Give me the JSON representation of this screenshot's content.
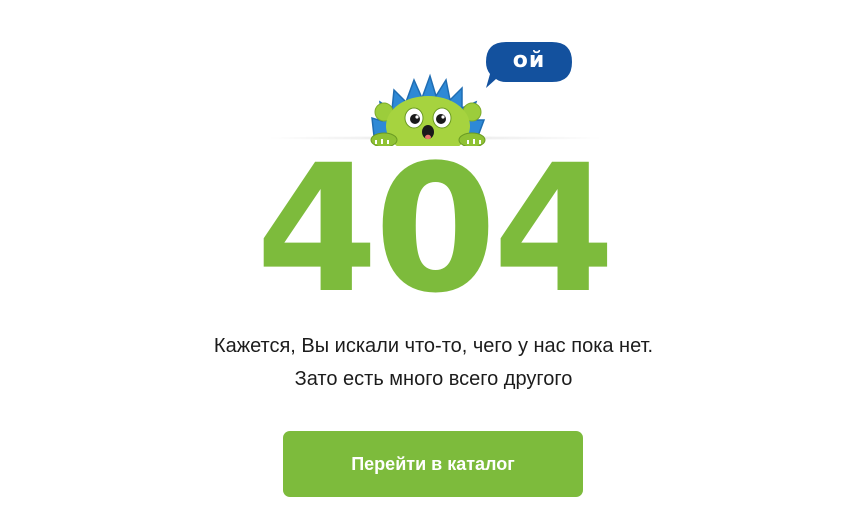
{
  "speech_bubble": {
    "text": "ой"
  },
  "error": {
    "code": "404"
  },
  "message": {
    "line1": "Кажется, Вы искали что-то, чего у нас пока нет.",
    "line2": "Зато есть много всего другого"
  },
  "button": {
    "label": "Перейти в каталог"
  },
  "colors": {
    "accent_green": "#7dbb3c",
    "bubble_blue": "#13519e",
    "text_dark": "#1c1c1c"
  },
  "icons": {
    "mascot": "hedgehog-mascot-icon",
    "bubble": "speech-bubble-icon"
  }
}
